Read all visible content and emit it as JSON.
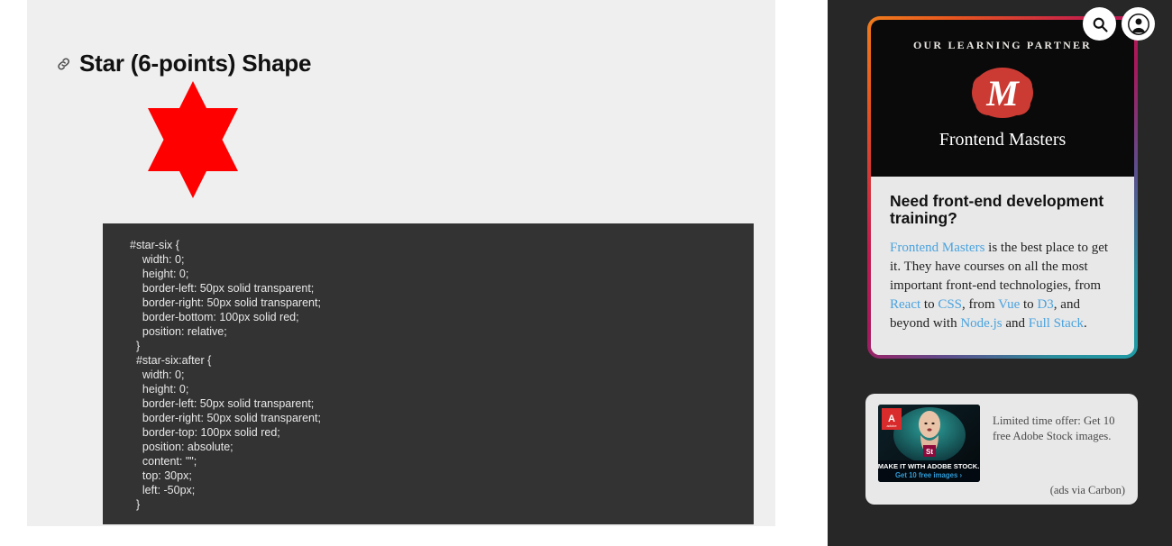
{
  "main": {
    "title": "Star (6-points) Shape",
    "anchor_icon": "link-icon",
    "shape_name": "six-pointed-star",
    "shape_color": "#ff0000",
    "code": "#star-six {\n    width: 0;\n    height: 0;\n    border-left: 50px solid transparent;\n    border-right: 50px solid transparent;\n    border-bottom: 100px solid red;\n    position: relative;\n  }\n  #star-six:after {\n    width: 0;\n    height: 0;\n    border-left: 50px solid transparent;\n    border-right: 50px solid transparent;\n    border-top: 100px solid red;\n    position: absolute;\n    content: \"\";\n    top: 30px;\n    left: -50px;\n  }"
  },
  "topbar": {
    "search_icon": "search-icon",
    "account_icon": "user-account-icon"
  },
  "sidebar": {
    "frontend_masters_ad": {
      "kicker": "OUR LEARNING PARTNER",
      "logo_icon": "frontend-masters-m-logo",
      "brand": "Frontend Masters",
      "heading": "Need front-end development training?",
      "body_parts": [
        {
          "text": "Frontend Masters",
          "link": true
        },
        {
          "text": " is the best place to get it. They have courses on all the most important front-end technologies, from ",
          "link": false
        },
        {
          "text": "React",
          "link": true
        },
        {
          "text": " to ",
          "link": false
        },
        {
          "text": "CSS",
          "link": true
        },
        {
          "text": ", from ",
          "link": false
        },
        {
          "text": "Vue",
          "link": true
        },
        {
          "text": " to ",
          "link": false
        },
        {
          "text": "D3",
          "link": true
        },
        {
          "text": ", and beyond with ",
          "link": false
        },
        {
          "text": "Node.js",
          "link": true
        },
        {
          "text": " and ",
          "link": false
        },
        {
          "text": "Full Stack",
          "link": true
        },
        {
          "text": ".",
          "link": false
        }
      ],
      "link_color": "#4aa3df",
      "border_gradient": [
        "#f07d1c",
        "#c21b4e",
        "#1f9ba5"
      ]
    },
    "carbon_ad": {
      "copy": "Limited time offer: Get 10 free Adobe Stock images.",
      "credit": "(ads via Carbon)",
      "thumb_headline": "MAKE IT WITH ADOBE STOCK.",
      "thumb_cta": "Get 10 free images ›",
      "thumb_badge": "St",
      "thumb_logo": "adobe-logo",
      "thumb_logo_label": "Adobe"
    }
  }
}
